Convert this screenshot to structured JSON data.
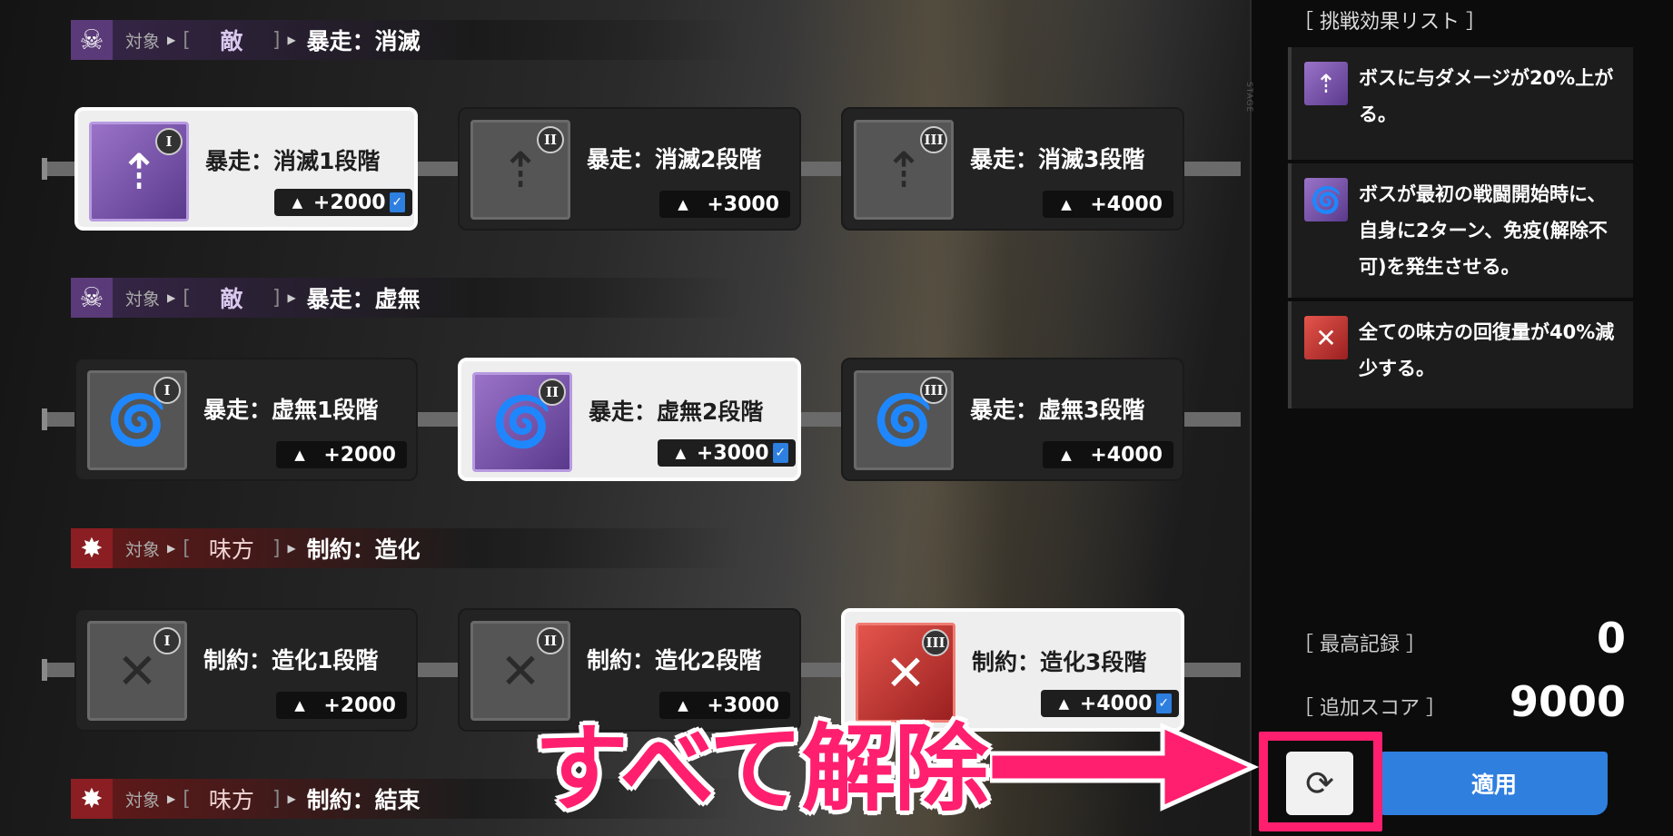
{
  "sections": [
    {
      "type": "enemy",
      "icon": "demon-icon",
      "target_label": "対象",
      "target_name": "敵",
      "effect_name": "暴走：消滅",
      "cards": [
        {
          "title": "暴走：消滅1段階",
          "score": "+2000",
          "tier": "I",
          "selected": true
        },
        {
          "title": "暴走：消滅2段階",
          "score": "+3000",
          "tier": "II",
          "selected": false
        },
        {
          "title": "暴走：消滅3段階",
          "score": "+4000",
          "tier": "III",
          "selected": false
        }
      ]
    },
    {
      "type": "enemy",
      "icon": "demon-icon",
      "target_label": "対象",
      "target_name": "敵",
      "effect_name": "暴走：虚無",
      "cards": [
        {
          "title": "暴走：虚無1段階",
          "score": "+2000",
          "tier": "I",
          "selected": false
        },
        {
          "title": "暴走：虚無2段階",
          "score": "+3000",
          "tier": "II",
          "selected": true
        },
        {
          "title": "暴走：虚無3段階",
          "score": "+4000",
          "tier": "III",
          "selected": false
        }
      ]
    },
    {
      "type": "ally",
      "icon": "starburst-icon",
      "target_label": "対象",
      "target_name": "味方",
      "effect_name": "制約：造化",
      "cards": [
        {
          "title": "制約：造化1段階",
          "score": "+2000",
          "tier": "I",
          "selected": false
        },
        {
          "title": "制約：造化2段階",
          "score": "+3000",
          "tier": "II",
          "selected": false
        },
        {
          "title": "制約：造化3段階",
          "score": "+4000",
          "tier": "III",
          "selected": true
        }
      ]
    },
    {
      "type": "ally",
      "icon": "starburst-icon",
      "target_label": "対象",
      "target_name": "味方",
      "effect_name": "制約：結束"
    }
  ],
  "panel": {
    "title": "［ 挑戦効果リスト ］",
    "effects": [
      {
        "text": "ボスに与ダメージが20%上がる。",
        "color": "purple"
      },
      {
        "text": "ボスが最初の戦闘開始時に、自身に2ターン、免疫(解除不可)を発生させる。",
        "color": "purple"
      },
      {
        "text": "全ての味方の回復量が40%減少する。",
        "color": "red"
      }
    ],
    "best_record_label": "［ 最高記録 ］",
    "best_record_value": "0",
    "bonus_score_label": "［ 追加スコア ］",
    "bonus_score_value": "9000",
    "apply_label": "適用",
    "reset_icon": "refresh-icon"
  },
  "annotation": {
    "text": "すべて解除",
    "color": "#ff1f6e"
  },
  "colors": {
    "purple_accent": "#7a55a8",
    "red_accent": "#c8322c",
    "apply_blue": "#2f7fdf",
    "highlight_pink": "#ff1f6e"
  }
}
